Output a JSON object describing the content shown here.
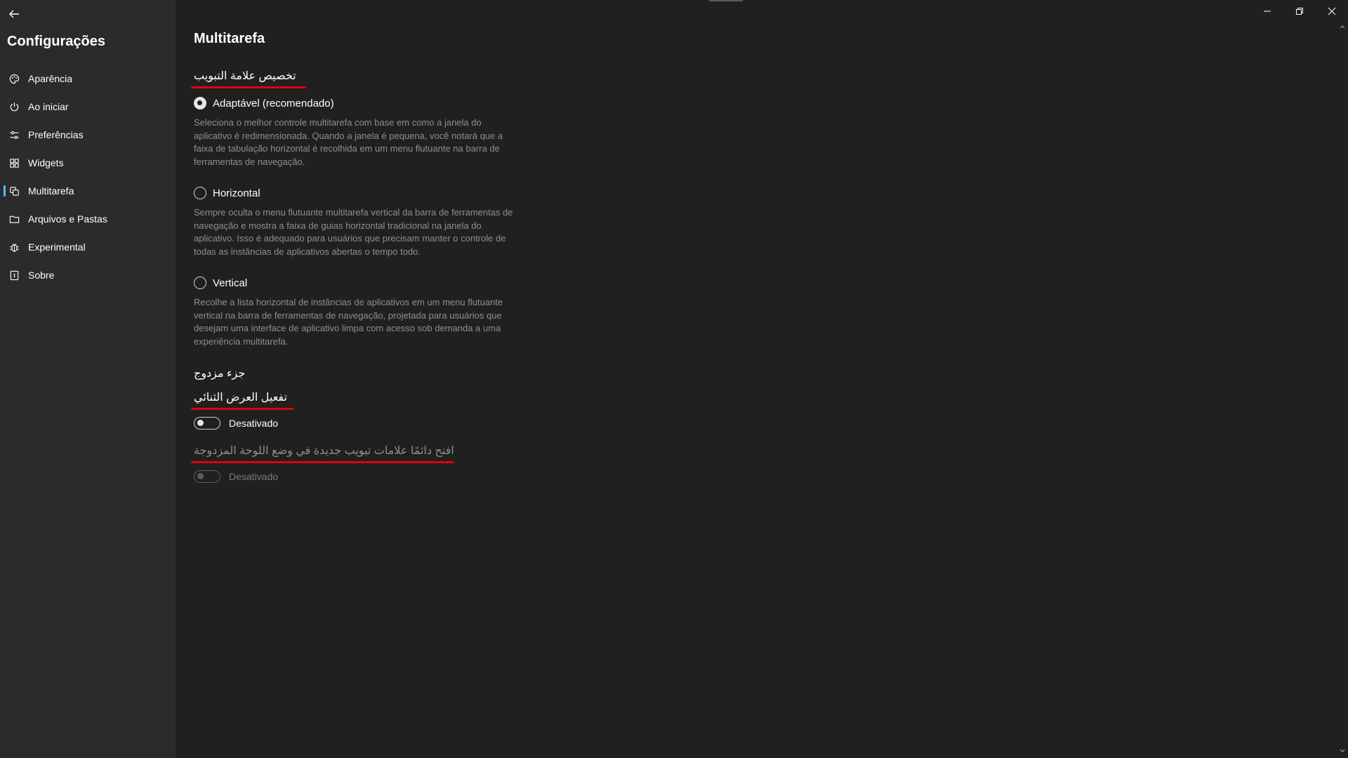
{
  "sidebar": {
    "title": "Configurações",
    "items": [
      {
        "label": "Aparência",
        "icon": "palette-icon"
      },
      {
        "label": "Ao iniciar",
        "icon": "power-icon"
      },
      {
        "label": "Preferências",
        "icon": "sliders-icon"
      },
      {
        "label": "Widgets",
        "icon": "grid-icon"
      },
      {
        "label": "Multitarefa",
        "icon": "copy-icon",
        "selected": true
      },
      {
        "label": "Arquivos e Pastas",
        "icon": "folder-icon"
      },
      {
        "label": "Experimental",
        "icon": "bug-icon"
      },
      {
        "label": "Sobre",
        "icon": "info-icon"
      }
    ]
  },
  "page": {
    "title": "Multitarefa"
  },
  "tab_customization": {
    "header": "تخصيص علامة التبويب",
    "options": [
      {
        "label": "Adaptável (recomendado)",
        "checked": true,
        "description": "Seleciona o melhor controle multitarefa com base em como a janela do aplicativo é redimensionada. Quando a janela é pequena, você notará que a faixa de tabulação horizontal é recolhida em um menu flutuante na barra de ferramentas de navegação."
      },
      {
        "label": "Horizontal",
        "checked": false,
        "description": "Sempre oculta o menu flutuante multitarefa vertical da barra de ferramentas de navegação e mostra a faixa de guias horizontal tradicional na janela do aplicativo. Isso é adequado para usuários que precisam manter o controle de todas as instâncias de aplicativos abertas o tempo todo."
      },
      {
        "label": "Vertical",
        "checked": false,
        "description": "Recolhe a lista horizontal de instâncias de aplicativos em um menu flutuante vertical na barra de ferramentas de navegação, projetada para usuários que desejam uma interface de aplicativo limpa com acesso sob demanda a uma experiência multitarefa."
      }
    ]
  },
  "dual_pane": {
    "header": "جزء مزدوج",
    "enable_label": "تفعيل العرض الثنائي",
    "enable_state": "Desativado",
    "always_open_label": "افتح دائمًا علامات تبويب جديدة في وضع اللوحة المزدوجة",
    "always_open_state": "Desativado"
  },
  "colors": {
    "background": "#202020",
    "sidebar": "#2b2b2b",
    "accent": "#4cc2ff",
    "annotation": "#e0000f"
  }
}
